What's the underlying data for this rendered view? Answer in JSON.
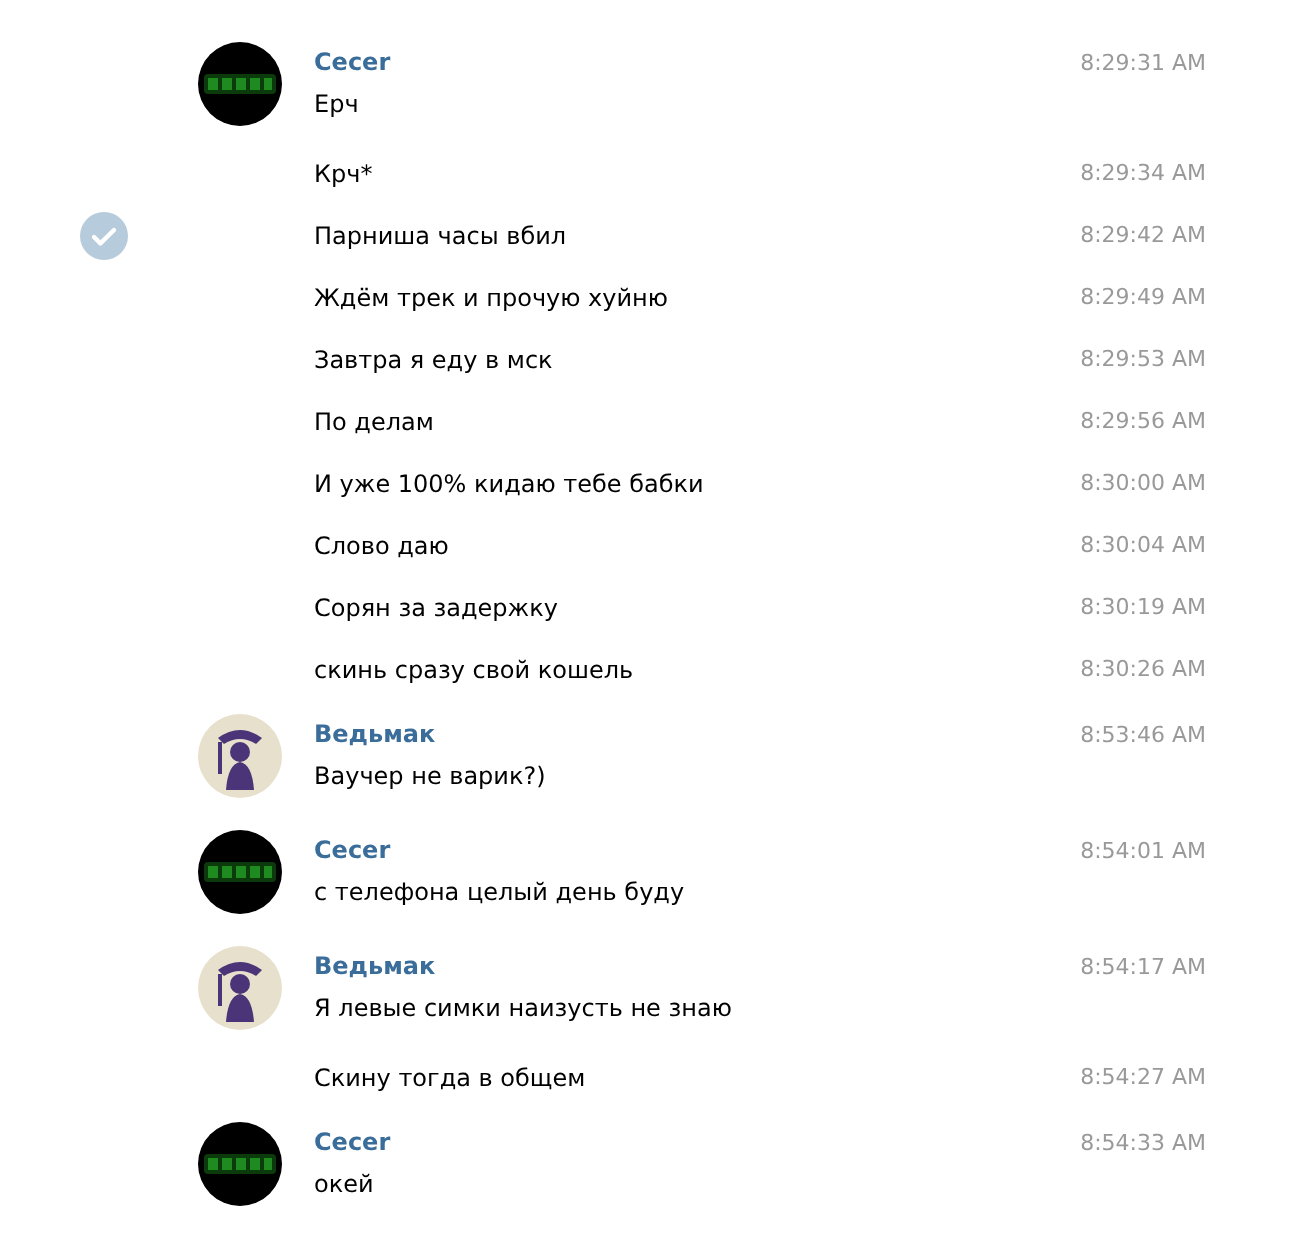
{
  "groups": [
    {
      "author": "Cecer",
      "avatar": {
        "kind": "dark"
      },
      "messages": [
        {
          "text": "Ерч",
          "time": "8:29:31 AM",
          "selected": false
        },
        {
          "text": "Крч*",
          "time": "8:29:34 AM",
          "selected": false
        },
        {
          "text": "Парниша часы вбил",
          "time": "8:29:42 AM",
          "selected": true
        },
        {
          "text": "Ждём трек и прочую хуйню",
          "time": "8:29:49 AM",
          "selected": false
        },
        {
          "text": "Завтра я еду в мск",
          "time": "8:29:53 AM",
          "selected": false
        },
        {
          "text": "По делам",
          "time": "8:29:56 AM",
          "selected": false
        },
        {
          "text": "И уже 100% кидаю тебе бабки",
          "time": "8:30:00 AM",
          "selected": false
        },
        {
          "text": "Слово даю",
          "time": "8:30:04 AM",
          "selected": false
        },
        {
          "text": "Сорян за задержку",
          "time": "8:30:19 AM",
          "selected": false
        },
        {
          "text": "скинь сразу свой кошель",
          "time": "8:30:26 AM",
          "selected": false
        }
      ]
    },
    {
      "author": "Ведьмак",
      "avatar": {
        "kind": "light"
      },
      "messages": [
        {
          "text": "Ваучер не варик?)",
          "time": "8:53:46 AM",
          "selected": false
        }
      ]
    },
    {
      "author": "Cecer",
      "avatar": {
        "kind": "dark"
      },
      "messages": [
        {
          "text": "с телефона целый день буду",
          "time": "8:54:01 AM",
          "selected": false
        }
      ]
    },
    {
      "author": "Ведьмак",
      "avatar": {
        "kind": "light"
      },
      "messages": [
        {
          "text": "Я левые симки наизусть не знаю",
          "time": "8:54:17 AM",
          "selected": false
        },
        {
          "text": "Скину тогда в общем",
          "time": "8:54:27 AM",
          "selected": false
        }
      ]
    },
    {
      "author": "Cecer",
      "avatar": {
        "kind": "dark"
      },
      "messages": [
        {
          "text": "окей",
          "time": "8:54:33 AM",
          "selected": false
        }
      ]
    }
  ]
}
